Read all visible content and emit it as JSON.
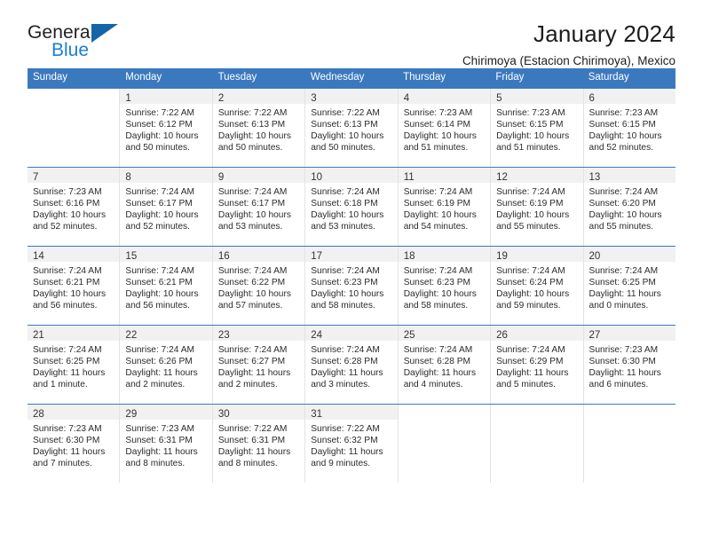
{
  "brand": {
    "name_part1": "General",
    "name_part2": "Blue",
    "triangle_color": "#1465a8",
    "blue_text_color": "#1b7fd4"
  },
  "header": {
    "title": "January 2024",
    "location": "Chirimoya (Estacion Chirimoya), Mexico"
  },
  "theme": {
    "header_blue": "#3b79bf",
    "daynum_band": "#f1f1f1",
    "cell_border": "#e3e3e3"
  },
  "weekdays": [
    "Sunday",
    "Monday",
    "Tuesday",
    "Wednesday",
    "Thursday",
    "Friday",
    "Saturday"
  ],
  "weeks": [
    [
      {
        "day": "",
        "lines": []
      },
      {
        "day": "1",
        "lines": [
          "Sunrise: 7:22 AM",
          "Sunset: 6:12 PM",
          "Daylight: 10 hours",
          "and 50 minutes."
        ]
      },
      {
        "day": "2",
        "lines": [
          "Sunrise: 7:22 AM",
          "Sunset: 6:13 PM",
          "Daylight: 10 hours",
          "and 50 minutes."
        ]
      },
      {
        "day": "3",
        "lines": [
          "Sunrise: 7:22 AM",
          "Sunset: 6:13 PM",
          "Daylight: 10 hours",
          "and 50 minutes."
        ]
      },
      {
        "day": "4",
        "lines": [
          "Sunrise: 7:23 AM",
          "Sunset: 6:14 PM",
          "Daylight: 10 hours",
          "and 51 minutes."
        ]
      },
      {
        "day": "5",
        "lines": [
          "Sunrise: 7:23 AM",
          "Sunset: 6:15 PM",
          "Daylight: 10 hours",
          "and 51 minutes."
        ]
      },
      {
        "day": "6",
        "lines": [
          "Sunrise: 7:23 AM",
          "Sunset: 6:15 PM",
          "Daylight: 10 hours",
          "and 52 minutes."
        ]
      }
    ],
    [
      {
        "day": "7",
        "lines": [
          "Sunrise: 7:23 AM",
          "Sunset: 6:16 PM",
          "Daylight: 10 hours",
          "and 52 minutes."
        ]
      },
      {
        "day": "8",
        "lines": [
          "Sunrise: 7:24 AM",
          "Sunset: 6:17 PM",
          "Daylight: 10 hours",
          "and 52 minutes."
        ]
      },
      {
        "day": "9",
        "lines": [
          "Sunrise: 7:24 AM",
          "Sunset: 6:17 PM",
          "Daylight: 10 hours",
          "and 53 minutes."
        ]
      },
      {
        "day": "10",
        "lines": [
          "Sunrise: 7:24 AM",
          "Sunset: 6:18 PM",
          "Daylight: 10 hours",
          "and 53 minutes."
        ]
      },
      {
        "day": "11",
        "lines": [
          "Sunrise: 7:24 AM",
          "Sunset: 6:19 PM",
          "Daylight: 10 hours",
          "and 54 minutes."
        ]
      },
      {
        "day": "12",
        "lines": [
          "Sunrise: 7:24 AM",
          "Sunset: 6:19 PM",
          "Daylight: 10 hours",
          "and 55 minutes."
        ]
      },
      {
        "day": "13",
        "lines": [
          "Sunrise: 7:24 AM",
          "Sunset: 6:20 PM",
          "Daylight: 10 hours",
          "and 55 minutes."
        ]
      }
    ],
    [
      {
        "day": "14",
        "lines": [
          "Sunrise: 7:24 AM",
          "Sunset: 6:21 PM",
          "Daylight: 10 hours",
          "and 56 minutes."
        ]
      },
      {
        "day": "15",
        "lines": [
          "Sunrise: 7:24 AM",
          "Sunset: 6:21 PM",
          "Daylight: 10 hours",
          "and 56 minutes."
        ]
      },
      {
        "day": "16",
        "lines": [
          "Sunrise: 7:24 AM",
          "Sunset: 6:22 PM",
          "Daylight: 10 hours",
          "and 57 minutes."
        ]
      },
      {
        "day": "17",
        "lines": [
          "Sunrise: 7:24 AM",
          "Sunset: 6:23 PM",
          "Daylight: 10 hours",
          "and 58 minutes."
        ]
      },
      {
        "day": "18",
        "lines": [
          "Sunrise: 7:24 AM",
          "Sunset: 6:23 PM",
          "Daylight: 10 hours",
          "and 58 minutes."
        ]
      },
      {
        "day": "19",
        "lines": [
          "Sunrise: 7:24 AM",
          "Sunset: 6:24 PM",
          "Daylight: 10 hours",
          "and 59 minutes."
        ]
      },
      {
        "day": "20",
        "lines": [
          "Sunrise: 7:24 AM",
          "Sunset: 6:25 PM",
          "Daylight: 11 hours",
          "and 0 minutes."
        ]
      }
    ],
    [
      {
        "day": "21",
        "lines": [
          "Sunrise: 7:24 AM",
          "Sunset: 6:25 PM",
          "Daylight: 11 hours",
          "and 1 minute."
        ]
      },
      {
        "day": "22",
        "lines": [
          "Sunrise: 7:24 AM",
          "Sunset: 6:26 PM",
          "Daylight: 11 hours",
          "and 2 minutes."
        ]
      },
      {
        "day": "23",
        "lines": [
          "Sunrise: 7:24 AM",
          "Sunset: 6:27 PM",
          "Daylight: 11 hours",
          "and 2 minutes."
        ]
      },
      {
        "day": "24",
        "lines": [
          "Sunrise: 7:24 AM",
          "Sunset: 6:28 PM",
          "Daylight: 11 hours",
          "and 3 minutes."
        ]
      },
      {
        "day": "25",
        "lines": [
          "Sunrise: 7:24 AM",
          "Sunset: 6:28 PM",
          "Daylight: 11 hours",
          "and 4 minutes."
        ]
      },
      {
        "day": "26",
        "lines": [
          "Sunrise: 7:24 AM",
          "Sunset: 6:29 PM",
          "Daylight: 11 hours",
          "and 5 minutes."
        ]
      },
      {
        "day": "27",
        "lines": [
          "Sunrise: 7:23 AM",
          "Sunset: 6:30 PM",
          "Daylight: 11 hours",
          "and 6 minutes."
        ]
      }
    ],
    [
      {
        "day": "28",
        "lines": [
          "Sunrise: 7:23 AM",
          "Sunset: 6:30 PM",
          "Daylight: 11 hours",
          "and 7 minutes."
        ]
      },
      {
        "day": "29",
        "lines": [
          "Sunrise: 7:23 AM",
          "Sunset: 6:31 PM",
          "Daylight: 11 hours",
          "and 8 minutes."
        ]
      },
      {
        "day": "30",
        "lines": [
          "Sunrise: 7:22 AM",
          "Sunset: 6:31 PM",
          "Daylight: 11 hours",
          "and 8 minutes."
        ]
      },
      {
        "day": "31",
        "lines": [
          "Sunrise: 7:22 AM",
          "Sunset: 6:32 PM",
          "Daylight: 11 hours",
          "and 9 minutes."
        ]
      },
      {
        "day": "",
        "lines": []
      },
      {
        "day": "",
        "lines": []
      },
      {
        "day": "",
        "lines": []
      }
    ]
  ]
}
